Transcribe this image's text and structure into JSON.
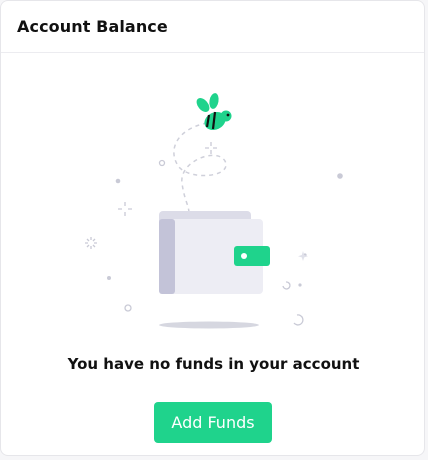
{
  "card": {
    "title": "Account Balance"
  },
  "empty_state": {
    "message": "You have no funds in your account",
    "illustration_icons": [
      "bee-icon",
      "wallet-icon"
    ]
  },
  "actions": {
    "add_funds_label": "Add Funds"
  },
  "colors": {
    "accent": "#1fd38c",
    "wallet_body": "#ededf4",
    "wallet_side": "#c3c3d8",
    "decor": "#c9cad6",
    "text": "#111111"
  }
}
